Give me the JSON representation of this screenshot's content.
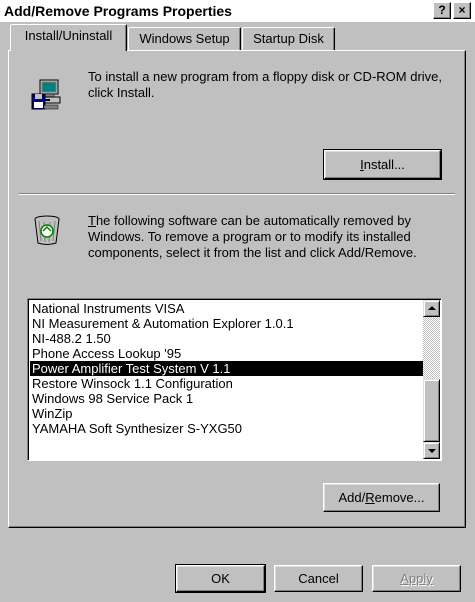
{
  "window": {
    "title": "Add/Remove Programs Properties",
    "help_glyph": "?",
    "close_glyph": "×"
  },
  "tabs": [
    {
      "label": "Install/Uninstall",
      "active": true
    },
    {
      "label": "Windows Setup",
      "active": false
    },
    {
      "label": "Startup Disk",
      "active": false
    }
  ],
  "install_section": {
    "icon": "computer-disk-icon",
    "description": "To install a new program from a floppy disk or CD-ROM drive, click Install.",
    "button_label_mnemonic": "I",
    "button_label_rest": "nstall..."
  },
  "remove_section": {
    "icon": "recycle-bin-icon",
    "description_mnemonic": "T",
    "description_rest": "he following software can be automatically removed by Windows. To remove a program or to modify its installed components, select it from the list and click Add/Remove.",
    "button_label_pre": "Add/",
    "button_label_mnemonic": "R",
    "button_label_rest": "emove..."
  },
  "programs": [
    "National Instruments VISA",
    "NI Measurement & Automation Explorer 1.0.1",
    "NI-488.2 1.50",
    "Phone Access Lookup '95",
    "Power Amplifier Test System V 1.1",
    "Restore Winsock 1.1 Configuration",
    "Windows 98 Service Pack 1",
    "WinZip",
    "YAMAHA Soft Synthesizer S-YXG50"
  ],
  "selected_program": "Power Amplifier Test System V 1.1",
  "footer": {
    "ok_label": "OK",
    "cancel_label": "Cancel",
    "apply_label": "Apply",
    "apply_enabled": false
  }
}
